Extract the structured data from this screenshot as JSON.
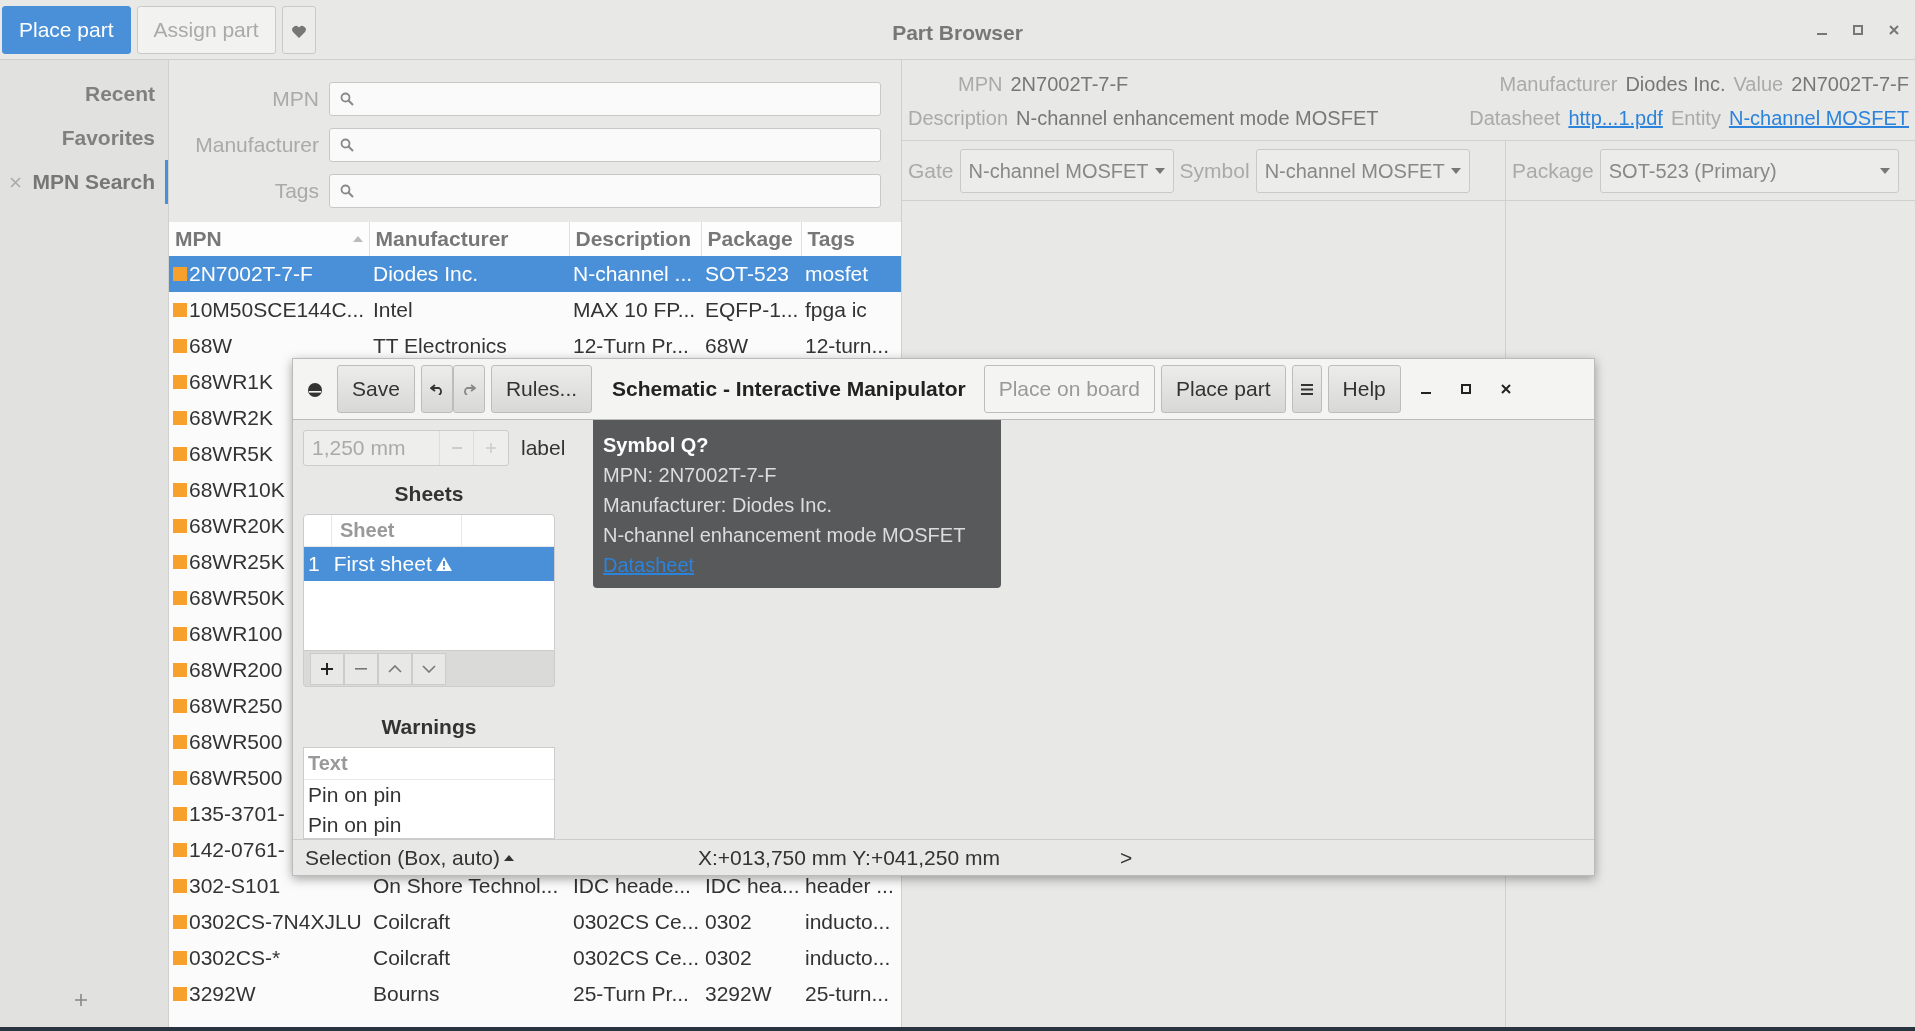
{
  "window": {
    "title": "Part Browser"
  },
  "toolbar": {
    "buttons": [
      {
        "kind": "primary",
        "label": "Place part",
        "disabled": false
      },
      {
        "kind": "text",
        "label": "Assign part",
        "disabled": true
      },
      {
        "kind": "favorite"
      }
    ]
  },
  "sidebar": {
    "items": [
      {
        "label": "Recent",
        "selected": false,
        "closable": false
      },
      {
        "label": "Favorites",
        "selected": false,
        "closable": false
      },
      {
        "label": "MPN Search",
        "selected": true,
        "closable": true
      }
    ]
  },
  "search": {
    "fields": [
      {
        "label": "MPN"
      },
      {
        "label": "Manufacturer"
      },
      {
        "label": "Tags"
      }
    ]
  },
  "table": {
    "columns": [
      {
        "label": "MPN",
        "sorted": true
      },
      {
        "label": "Manufacturer",
        "sorted": false
      },
      {
        "label": "Description",
        "sorted": false
      },
      {
        "label": "Package",
        "sorted": false
      },
      {
        "label": "Tags",
        "sorted": false
      }
    ],
    "rows": [
      {
        "selected": true,
        "cells": [
          "2N7002T-7-F",
          "Diodes Inc.",
          "N-channel ...",
          "SOT-523",
          "mosfet"
        ]
      },
      {
        "selected": false,
        "cells": [
          "10M50SCE144C...",
          "Intel",
          "MAX 10 FP...",
          "EQFP-1...",
          "fpga ic"
        ]
      },
      {
        "selected": false,
        "cells": [
          "68W",
          "TT Electronics",
          "12-Turn Pr...",
          "68W",
          "12-turn..."
        ]
      },
      {
        "selected": false,
        "cells": [
          "68WR1K"
        ]
      },
      {
        "selected": false,
        "cells": [
          "68WR2K"
        ]
      },
      {
        "selected": false,
        "cells": [
          "68WR5K"
        ]
      },
      {
        "selected": false,
        "cells": [
          "68WR10K"
        ]
      },
      {
        "selected": false,
        "cells": [
          "68WR20K"
        ]
      },
      {
        "selected": false,
        "cells": [
          "68WR25K"
        ]
      },
      {
        "selected": false,
        "cells": [
          "68WR50K"
        ]
      },
      {
        "selected": false,
        "cells": [
          "68WR100"
        ]
      },
      {
        "selected": false,
        "cells": [
          "68WR200"
        ]
      },
      {
        "selected": false,
        "cells": [
          "68WR250"
        ]
      },
      {
        "selected": false,
        "cells": [
          "68WR500"
        ]
      },
      {
        "selected": false,
        "cells": [
          "68WR500"
        ]
      },
      {
        "selected": false,
        "cells": [
          "135-3701-"
        ]
      },
      {
        "selected": false,
        "cells": [
          "142-0761-"
        ]
      },
      {
        "selected": false,
        "cells": [
          "302-S101",
          "On Shore Technol...",
          "IDC heade...",
          "IDC hea...",
          "header ..."
        ]
      },
      {
        "selected": false,
        "cells": [
          "0302CS-7N4XJLU",
          "Coilcraft",
          "0302CS Ce...",
          "0302",
          "inducto..."
        ]
      },
      {
        "selected": false,
        "cells": [
          "0302CS-*",
          "Coilcraft",
          "0302CS Ce...",
          "0302",
          "inducto..."
        ]
      },
      {
        "selected": false,
        "cells": [
          "3292W",
          "Bourns",
          "25-Turn Pr...",
          "3292W",
          "25-turn..."
        ]
      }
    ]
  },
  "details": {
    "rows": [
      {
        "left": [
          {
            "kind": "text",
            "label": "MPN",
            "value": "2N7002T-7-F"
          }
        ],
        "right": [
          {
            "kind": "text",
            "label": "Manufacturer",
            "value": "Diodes Inc."
          },
          {
            "kind": "text",
            "label": "Value",
            "value": "2N7002T-7-F"
          }
        ]
      },
      {
        "left": [
          {
            "kind": "text",
            "label": "Description",
            "value": "N-channel enhancement mode MOSFET"
          }
        ],
        "right": [
          {
            "kind": "link",
            "label": "Datasheet",
            "value": "http...1.pdf"
          },
          {
            "kind": "link",
            "label": "Entity",
            "value": "N-channel MOSFET"
          }
        ]
      }
    ]
  },
  "selectors": [
    {
      "label": "Gate",
      "value": "N-channel MOSFET"
    },
    {
      "label": "Symbol",
      "value": "N-channel MOSFET"
    },
    {
      "label": "Package",
      "value": "SOT-523 (Primary)"
    }
  ],
  "dialog": {
    "title": "Schematic - Interactive Manipulator",
    "left_buttons": [
      {
        "kind": "save",
        "label": "Save"
      },
      {
        "kind": "undo-redo"
      },
      {
        "kind": "text",
        "label": "Rules..."
      }
    ],
    "right_buttons": [
      {
        "kind": "text",
        "label": "Place on board",
        "disabled": true
      },
      {
        "kind": "text",
        "label": "Place part",
        "disabled": false
      },
      {
        "kind": "menu",
        "disabled": false
      },
      {
        "kind": "text",
        "label": "Help",
        "disabled": false
      }
    ],
    "grid": {
      "value": "1,250 mm",
      "label": "label",
      "disabled": true
    },
    "sheets": {
      "title": "Sheets",
      "column": "Sheet",
      "rows": [
        {
          "index": "1",
          "name": "First sheet",
          "warning": true,
          "selected": true
        }
      ]
    },
    "warnings": {
      "title": "Warnings",
      "column": "Text",
      "rows": [
        "Pin on pin",
        "Pin on pin"
      ]
    },
    "tooltip": {
      "title": "Symbol Q?",
      "lines": [
        "MPN: 2N7002T-7-F",
        "Manufacturer: Diodes Inc.",
        "N-channel enhancement mode MOSFET"
      ],
      "link": "Datasheet"
    },
    "status": {
      "tool": "Selection (Box, auto)",
      "coords": "X:+013,750 mm Y:+041,250 mm",
      "more": ">"
    }
  }
}
